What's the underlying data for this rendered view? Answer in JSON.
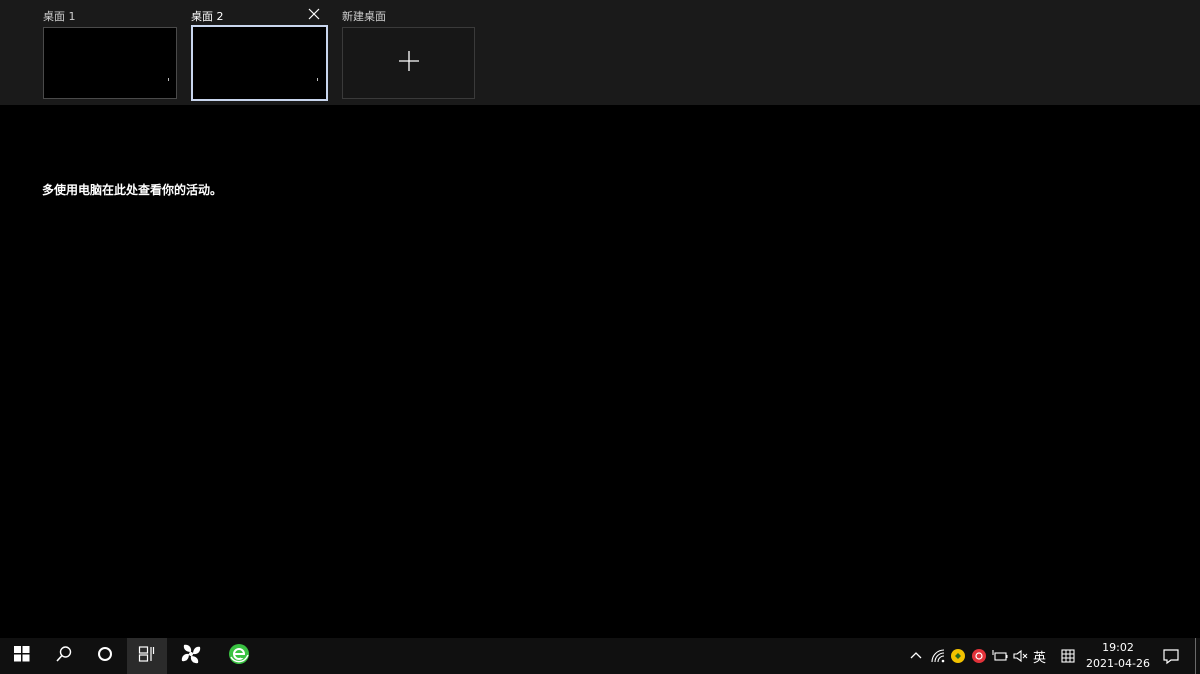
{
  "desktops": [
    {
      "label": "桌面 1",
      "active": false
    },
    {
      "label": "桌面 2",
      "active": true
    }
  ],
  "new_desktop": {
    "label": "新建桌面"
  },
  "activity": {
    "message": "多使用电脑在此处查看你的活动。"
  },
  "taskbar": {
    "apps": [
      "start-icon",
      "search-icon",
      "cortana-icon",
      "task-view-icon",
      "fan-app-icon",
      "browser-e-icon"
    ],
    "tray": {
      "ime_label": "英",
      "time": "19:02",
      "date": "2021-04-26"
    }
  },
  "colors": {
    "strip_bg": "#1a1a1a",
    "active_border": "#c9d6ee",
    "taskbar_bg": "#101010",
    "green_icon": "#3ac242",
    "tray_yellow": "#f2c200",
    "tray_red": "#e2323a"
  }
}
